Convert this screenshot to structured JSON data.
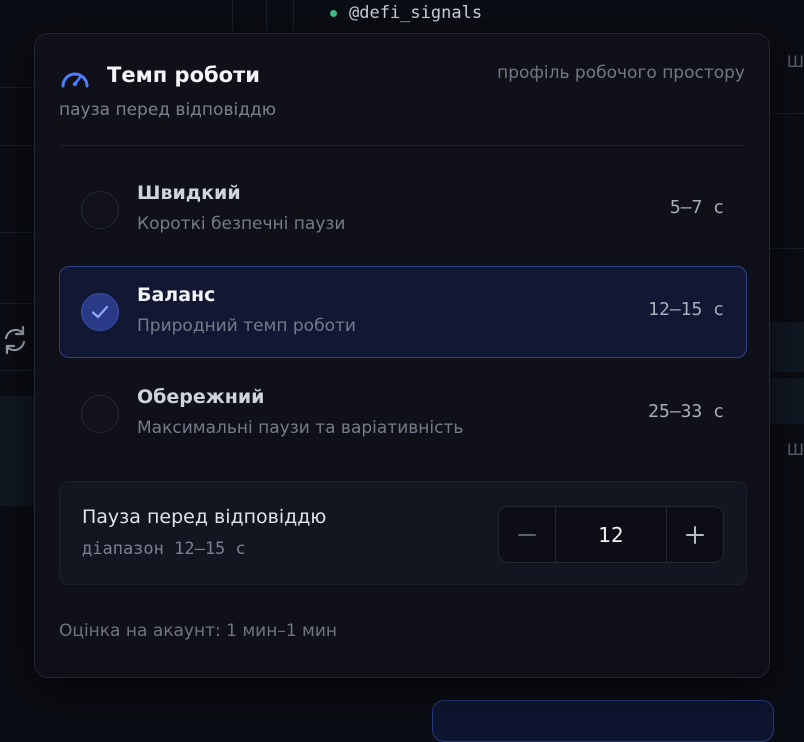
{
  "background": {
    "handle": "@defi_signals",
    "edge_label_1": "Ш",
    "edge_label_2": "Ш"
  },
  "panel": {
    "icon": "speedometer-icon",
    "title": "Темп роботи",
    "scope_label": "профіль робочого простору",
    "subtitle": "пауза перед відповіддю",
    "options": [
      {
        "name": "Швидкий",
        "description": "Короткі безпечні паузи",
        "range": "5–7 с",
        "selected": false
      },
      {
        "name": "Баланс",
        "description": "Природний темп роботи",
        "range": "12–15 с",
        "selected": true
      },
      {
        "name": "Обережний",
        "description": "Максимальні паузи та варіативність",
        "range": "25–33 с",
        "selected": false
      }
    ],
    "pause": {
      "title": "Пауза перед відповіддю",
      "range_label": "діапазон 12–15 с",
      "value": "12"
    },
    "estimate": "Оцінка на акаунт: 1 мин–1 мин"
  },
  "colors": {
    "accent": "#3b5bdb",
    "check": "#8ea8ff",
    "status_online": "#3ec48b"
  }
}
